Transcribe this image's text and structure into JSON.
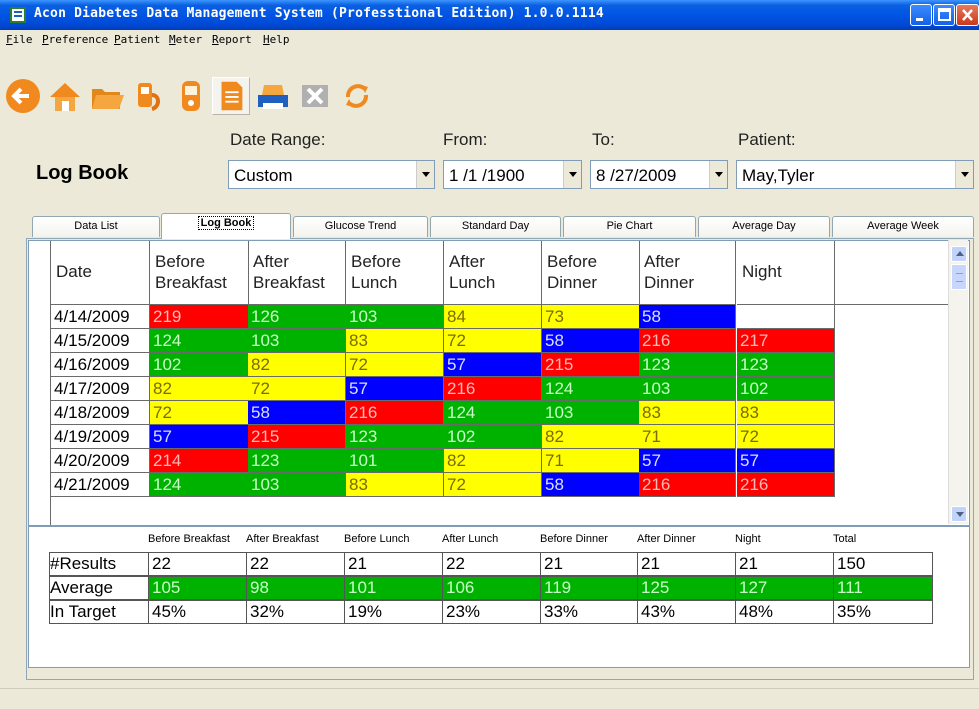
{
  "window": {
    "title": "Acon Diabetes Data Management System (Professtional Edition) 1.0.0.1114"
  },
  "menu": [
    "File",
    "Preference",
    "Patient",
    "Meter",
    "Report",
    "Help"
  ],
  "toolbar": [
    {
      "icon": "back-arrow-icon"
    },
    {
      "icon": "home-icon"
    },
    {
      "icon": "folder-icon"
    },
    {
      "icon": "download-meter-icon"
    },
    {
      "icon": "meter-icon"
    },
    {
      "icon": "logbook-document-icon",
      "pressed": true
    },
    {
      "icon": "printer-icon"
    },
    {
      "icon": "excel-export-icon"
    },
    {
      "icon": "refresh-icon"
    }
  ],
  "header": {
    "page_title": "Log Book",
    "date_range_label": "Date Range:",
    "date_range_value": "Custom",
    "from_label": "From:",
    "from_value": "1 /1 /1900",
    "to_label": "To:",
    "to_value": "8 /27/2009",
    "patient_label": "Patient:",
    "patient_value": "May,Tyler"
  },
  "tabs": [
    {
      "label": "Data List",
      "active": false
    },
    {
      "label": "Log Book",
      "active": true
    },
    {
      "label": "Glucose Trend",
      "active": false
    },
    {
      "label": "Standard Day",
      "active": false
    },
    {
      "label": "Pie Chart",
      "active": false
    },
    {
      "label": "Average Day",
      "active": false
    },
    {
      "label": "Average Week",
      "active": false
    }
  ],
  "grid": {
    "columns": [
      {
        "l1": "Date",
        "l2": ""
      },
      {
        "l1": "Before",
        "l2": "Breakfast"
      },
      {
        "l1": "After",
        "l2": "Breakfast"
      },
      {
        "l1": "Before",
        "l2": "Lunch"
      },
      {
        "l1": "After",
        "l2": "Lunch"
      },
      {
        "l1": "Before",
        "l2": "Dinner"
      },
      {
        "l1": "After",
        "l2": "Dinner"
      },
      {
        "l1": "Night",
        "l2": ""
      }
    ],
    "rows": [
      {
        "date": "4/14/2009",
        "cells": [
          {
            "v": "219",
            "c": "red"
          },
          {
            "v": "126",
            "c": "green"
          },
          {
            "v": "103",
            "c": "green"
          },
          {
            "v": "84",
            "c": "yellow"
          },
          {
            "v": "73",
            "c": "yellow"
          },
          {
            "v": "58",
            "c": "blue"
          },
          {
            "v": "",
            "c": "white"
          }
        ]
      },
      {
        "date": "4/15/2009",
        "cells": [
          {
            "v": "124",
            "c": "green"
          },
          {
            "v": "103",
            "c": "green"
          },
          {
            "v": "83",
            "c": "yellow"
          },
          {
            "v": "72",
            "c": "yellow"
          },
          {
            "v": "58",
            "c": "blue"
          },
          {
            "v": "216",
            "c": "red"
          },
          {
            "v": "217",
            "c": "red"
          }
        ]
      },
      {
        "date": "4/16/2009",
        "cells": [
          {
            "v": "102",
            "c": "green"
          },
          {
            "v": "82",
            "c": "yellow"
          },
          {
            "v": "72",
            "c": "yellow"
          },
          {
            "v": "57",
            "c": "blue"
          },
          {
            "v": "215",
            "c": "red"
          },
          {
            "v": "123",
            "c": "green"
          },
          {
            "v": "123",
            "c": "green"
          }
        ]
      },
      {
        "date": "4/17/2009",
        "cells": [
          {
            "v": "82",
            "c": "yellow"
          },
          {
            "v": "72",
            "c": "yellow"
          },
          {
            "v": "57",
            "c": "blue"
          },
          {
            "v": "216",
            "c": "red"
          },
          {
            "v": "124",
            "c": "green"
          },
          {
            "v": "103",
            "c": "green"
          },
          {
            "v": "102",
            "c": "green"
          }
        ]
      },
      {
        "date": "4/18/2009",
        "cells": [
          {
            "v": "72",
            "c": "yellow"
          },
          {
            "v": "58",
            "c": "blue"
          },
          {
            "v": "216",
            "c": "red"
          },
          {
            "v": "124",
            "c": "green"
          },
          {
            "v": "103",
            "c": "green"
          },
          {
            "v": "83",
            "c": "yellow"
          },
          {
            "v": "83",
            "c": "yellow"
          }
        ]
      },
      {
        "date": "4/19/2009",
        "cells": [
          {
            "v": "57",
            "c": "blue"
          },
          {
            "v": "215",
            "c": "red"
          },
          {
            "v": "123",
            "c": "green"
          },
          {
            "v": "102",
            "c": "green"
          },
          {
            "v": "82",
            "c": "yellow"
          },
          {
            "v": "71",
            "c": "yellow"
          },
          {
            "v": "72",
            "c": "yellow"
          }
        ]
      },
      {
        "date": "4/20/2009",
        "cells": [
          {
            "v": "214",
            "c": "red"
          },
          {
            "v": "123",
            "c": "green"
          },
          {
            "v": "101",
            "c": "green"
          },
          {
            "v": "82",
            "c": "yellow"
          },
          {
            "v": "71",
            "c": "yellow"
          },
          {
            "v": "57",
            "c": "blue"
          },
          {
            "v": "57",
            "c": "blue"
          }
        ]
      },
      {
        "date": "4/21/2009",
        "cells": [
          {
            "v": "124",
            "c": "green"
          },
          {
            "v": "103",
            "c": "green"
          },
          {
            "v": "83",
            "c": "yellow"
          },
          {
            "v": "72",
            "c": "yellow"
          },
          {
            "v": "58",
            "c": "blue"
          },
          {
            "v": "216",
            "c": "red"
          },
          {
            "v": "216",
            "c": "red"
          }
        ]
      }
    ]
  },
  "summary": {
    "headers": [
      "Before Breakfast",
      "After Breakfast",
      "Before Lunch",
      "After Lunch",
      "Before Dinner",
      "After Dinner",
      "Night",
      "Total"
    ],
    "rows": [
      {
        "label": "#Results",
        "color": "white",
        "values": [
          "22",
          "22",
          "21",
          "22",
          "21",
          "21",
          "21",
          "150"
        ]
      },
      {
        "label": "Average",
        "color": "green",
        "values": [
          "105",
          "98",
          "101",
          "106",
          "119",
          "125",
          "127",
          "111"
        ]
      },
      {
        "label": "In Target",
        "color": "white",
        "values": [
          "45%",
          "32%",
          "19%",
          "23%",
          "33%",
          "43%",
          "48%",
          "35%"
        ]
      }
    ]
  },
  "colors": {
    "red": "#FF0000",
    "green": "#00B200",
    "yellow": "#FFFF00",
    "blue": "#0000FF",
    "titlebar": "#0055E5"
  }
}
